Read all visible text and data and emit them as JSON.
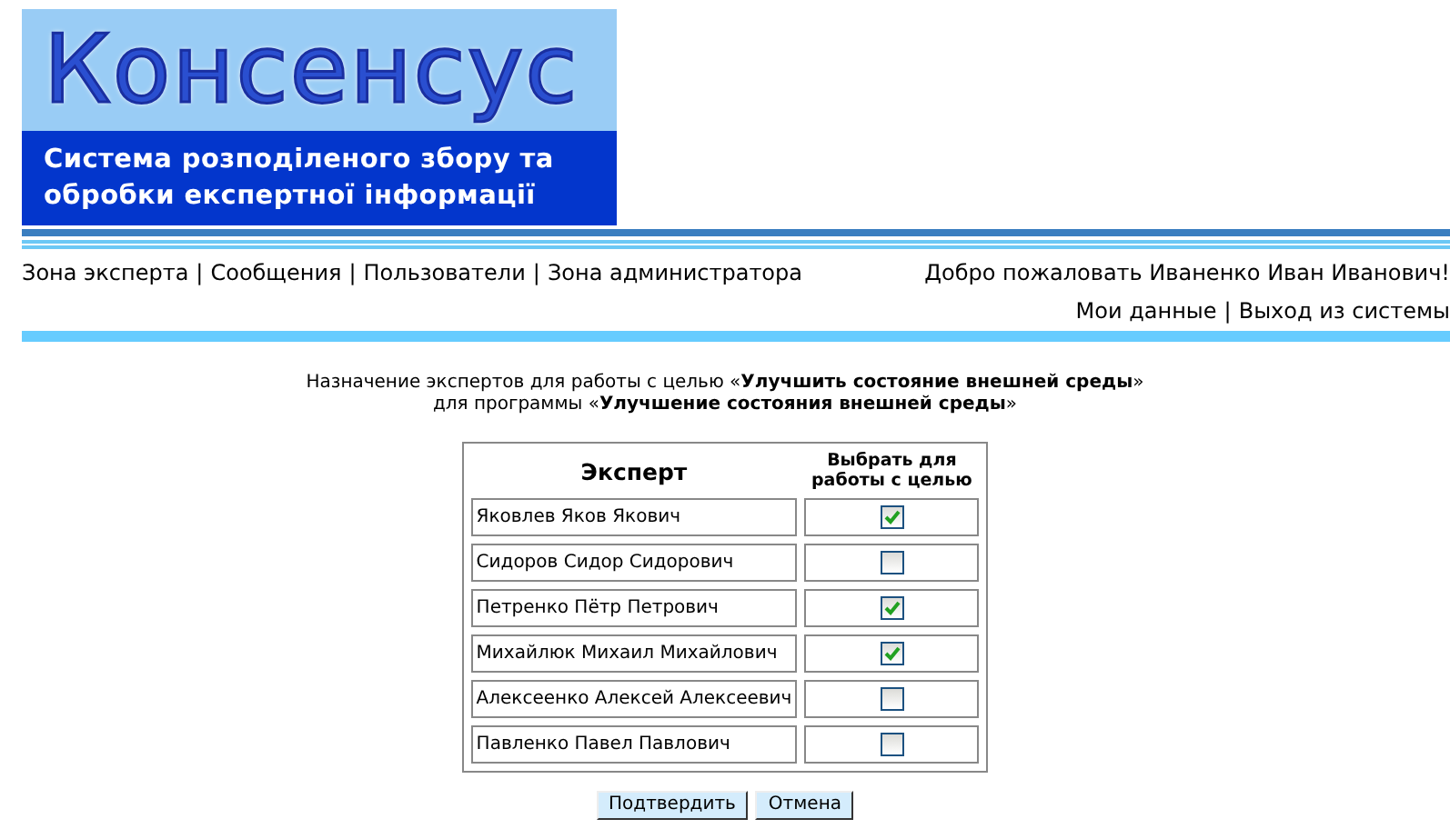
{
  "logo": {
    "title": "Консенсус",
    "subtitle_lines": [
      "Система розподіленого збору та",
      "обробки експертної інформації"
    ]
  },
  "nav": {
    "separator": "|",
    "items": [
      "Зона эксперта",
      "Сообщения",
      "Пользователи",
      "Зона администратора"
    ]
  },
  "welcome": "Добро пожаловать Иваненко Иван Иванович!",
  "user_links": [
    "Мои данные",
    "Выход из системы"
  ],
  "intro_lines": [
    "Назначение экспертов для работы с целью «**Улучшить состояние внешней среды**»",
    "для программы «**Улучшение состояния внешней среды**»"
  ],
  "table": {
    "columns": [
      "Эксперт",
      "Выбрать для работы с целью"
    ],
    "rows": [
      {
        "name": "Яковлев Яков Якович",
        "checked": true
      },
      {
        "name": "Сидоров Сидор Сидорович",
        "checked": false
      },
      {
        "name": "Петренко Пётр Петрович",
        "checked": true
      },
      {
        "name": "Михайлюк Михаил Михайлович",
        "checked": true
      },
      {
        "name": "Алексеенко Алексей Алексеевич",
        "checked": false
      },
      {
        "name": "Павленко Павел Павлович",
        "checked": false
      }
    ]
  },
  "buttons": [
    "Подтвердить",
    "Отмена"
  ]
}
